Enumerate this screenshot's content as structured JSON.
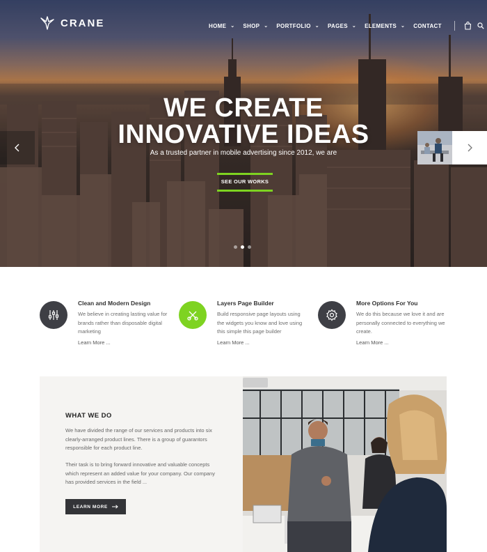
{
  "header": {
    "logo_text": "CRANE",
    "nav": [
      {
        "label": "HOME",
        "dropdown": true
      },
      {
        "label": "SHOP",
        "dropdown": true
      },
      {
        "label": "PORTFOLIO",
        "dropdown": true
      },
      {
        "label": "PAGES",
        "dropdown": true
      },
      {
        "label": "ELEMENTS",
        "dropdown": true
      },
      {
        "label": "CONTACT",
        "dropdown": false
      }
    ],
    "icons": [
      "cart-icon",
      "search-icon"
    ]
  },
  "hero": {
    "title_line1": "WE CREATE",
    "title_line2": "INNOVATIVE IDEAS",
    "subtitle": "As a trusted partner in mobile advertising since 2012, we are",
    "button_label": "SEE OUR WORKS",
    "slide_count": 3,
    "active_slide": 2
  },
  "features": [
    {
      "icon": "sliders-icon",
      "title": "Clean and Modern Design",
      "text": "We believe in creating lasting value for brands rather than disposable digital marketing",
      "more": "Learn More ..."
    },
    {
      "icon": "tools-icon",
      "title": "Layers Page Builder",
      "text": "Build responsive page layouts using the widgets you know and love using this simple this page builder",
      "more": "Learn More ..."
    },
    {
      "icon": "gear-icon",
      "title": "More Options For You",
      "text": "We do this because we love it and are personally connected to everything we create.",
      "more": "Learn More ..."
    }
  ],
  "what_we_do": {
    "title": "WHAT WE DO",
    "paragraph1": "We have divided the range of our services and products into six clearly-arranged product lines. There is a group of guarantors responsible for each product line.",
    "paragraph2": "Their task is to bring forward innovative and valuable concepts which represent an added value for your company. Our company has provided services in the field ...",
    "button_label": "LEARN MORE"
  },
  "colors": {
    "accent": "#7ed321",
    "dark": "#333438",
    "panel": "#f5f4f2"
  }
}
